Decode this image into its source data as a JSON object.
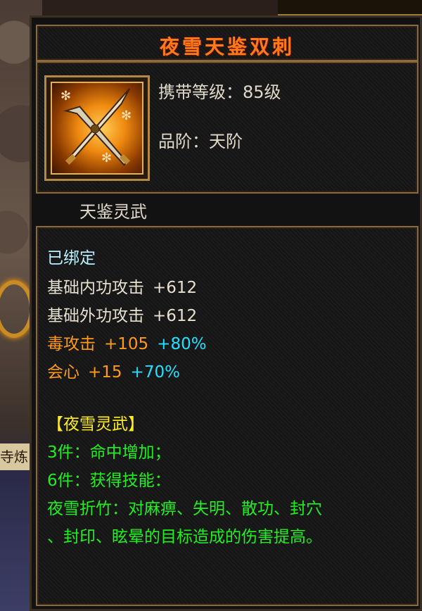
{
  "item": {
    "name": "夜雪天鉴双刺",
    "level_label": "携带等级：",
    "level_value": "85级",
    "grade_label": "品阶：",
    "grade_value": "天阶",
    "category": "天鉴灵武"
  },
  "stats": {
    "bound": "已绑定",
    "inner_attack_label": "基础内功攻击",
    "inner_attack_value": "+612",
    "outer_attack_label": "基础外功攻击",
    "outer_attack_value": "+612",
    "poison_label": "毒攻击",
    "poison_value": "+105",
    "poison_bonus": "+80%",
    "crit_label": "会心",
    "crit_value": "+15",
    "crit_bonus": "+70%"
  },
  "set": {
    "name": "【夜雪灵武】",
    "bonus3": "3件：命中增加；",
    "bonus6": "6件：获得技能：",
    "skill_line1": "夜雪折竹：对麻痹、失明、散功、封穴",
    "skill_line2": "、封印、眩晕的目标造成的伤害提高。"
  },
  "background": {
    "side_label": "寺炼"
  },
  "colors": {
    "title": "#ff7a1a",
    "bonus": "#22e0ff",
    "set_name": "#ffee22",
    "set_text": "#22ee22",
    "attr": "#ff9a1a"
  }
}
